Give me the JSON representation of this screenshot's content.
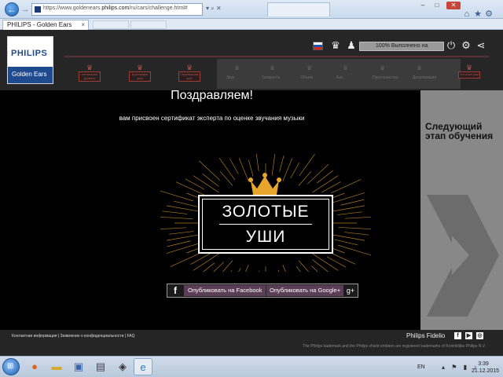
{
  "browser": {
    "address": {
      "prefix": "https://www.goldenears.",
      "domain": "philips.com",
      "path": "/ru/cars/challenge.html#"
    },
    "tab_title": "PHILIPS - Golden Ears",
    "tab_close": "×",
    "window_controls": {
      "minimize": "–",
      "maximize": "□",
      "close": "✕"
    }
  },
  "header": {
    "logo_text": "PHILIPS",
    "logo_subtitle": "Golden Ears",
    "progress_label": "100% Выполнено на",
    "stages": [
      "Начальный уровень",
      "Бронзовые уши",
      "Серебряные уши",
      "Золотые уши"
    ],
    "locked_items": [
      "Звук",
      "Громкость",
      "Объем",
      "Бас",
      "Пространство",
      "Детализация"
    ]
  },
  "main": {
    "congrats": "Поздравляем!",
    "subtitle": "вам присвоен сертификат эксперта по оценке звучания музыки",
    "badge_line1": "ЗОЛОТЫЕ",
    "badge_line2": "УШИ",
    "share_facebook": "Опубликовать на Facebook",
    "share_google": "Опубликовать на Google+",
    "google_icon": "g+",
    "facebook_icon": "f"
  },
  "next_panel": {
    "title": "Следующий этап обучения"
  },
  "footer": {
    "links": "Контактная информация | Заявление о конфиденциальности | FAQ",
    "brand": "Philips Fidelio",
    "trademark": "The Philips trademark and the Philips shield emblem are registered trademarks of Koninklijke Philips N.V."
  },
  "taskbar": {
    "lang": "EN",
    "time": "3:39",
    "date": "21.12.2015"
  },
  "colors": {
    "accent": "#1f4b8e",
    "stage_red": "#b0504a",
    "gold": "#e8a52c"
  }
}
